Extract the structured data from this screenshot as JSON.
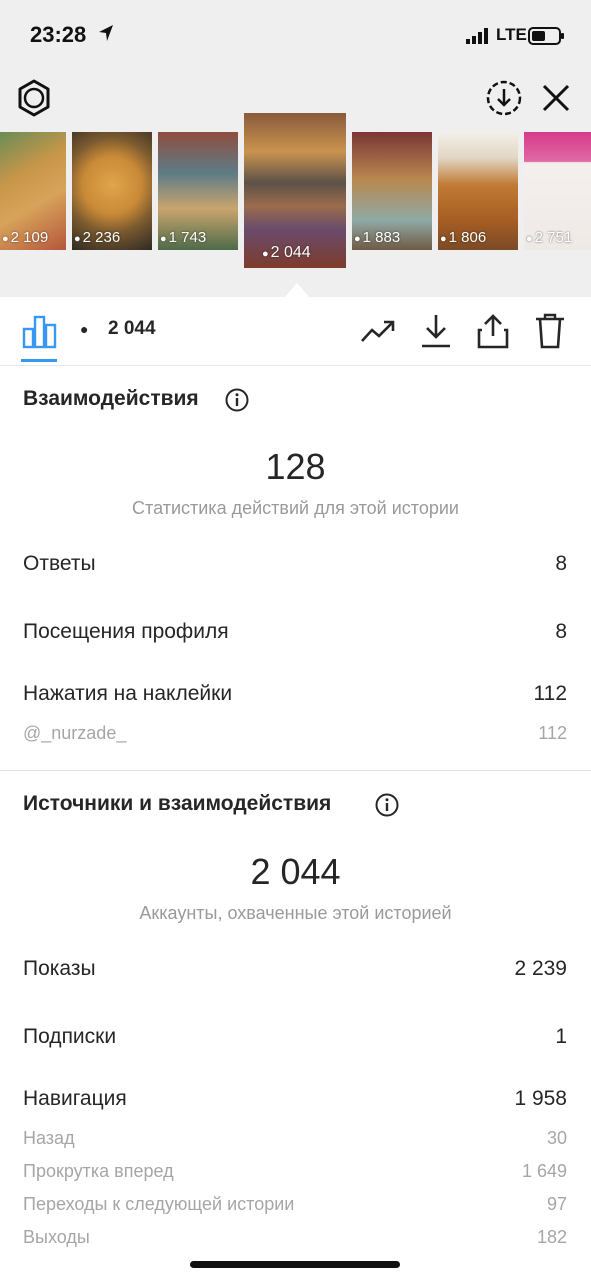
{
  "status_bar": {
    "time": "23:28",
    "network": "LTE"
  },
  "thumbnails": [
    {
      "views": "2 109"
    },
    {
      "views": "2 236"
    },
    {
      "views": "1 743"
    },
    {
      "views": "2 044",
      "selected": true
    },
    {
      "views": "1 883"
    },
    {
      "views": "1 806"
    },
    {
      "views": "2 751"
    }
  ],
  "toolbar": {
    "view_count": "2 044"
  },
  "interactions": {
    "title": "Взаимодействия",
    "total": "128",
    "caption": "Статистика действий для этой истории",
    "rows": [
      {
        "label": "Ответы",
        "value": "8"
      },
      {
        "label": "Посещения профиля",
        "value": "8"
      },
      {
        "label": "Нажатия на наклейки",
        "value": "112"
      }
    ],
    "sub_rows": [
      {
        "label": "@_nurzade_",
        "value": "112"
      }
    ]
  },
  "discovery": {
    "title": "Источники и взаимодействия",
    "total": "2 044",
    "caption": "Аккаунты, охваченные этой историей",
    "rows": [
      {
        "label": "Показы",
        "value": "2 239"
      },
      {
        "label": "Подписки",
        "value": "1"
      },
      {
        "label": "Навигация",
        "value": "1 958"
      }
    ],
    "sub_rows": [
      {
        "label": "Назад",
        "value": "30"
      },
      {
        "label": "Прокрутка вперед",
        "value": "1 649"
      },
      {
        "label": "Переходы к следующей истории",
        "value": "97"
      },
      {
        "label": "Выходы",
        "value": "182"
      }
    ]
  },
  "colors": {
    "accent": "#3897f0",
    "text": "#262626",
    "muted": "#9a9a9a",
    "header_bg": "#efefef"
  },
  "icons": [
    "location-arrow-icon",
    "signal-icon",
    "battery-icon",
    "settings-gear-icon",
    "download-circle-icon",
    "close-icon",
    "bar-chart-icon",
    "eye-icon",
    "trend-icon",
    "download-icon",
    "share-icon",
    "trash-icon",
    "info-icon"
  ]
}
